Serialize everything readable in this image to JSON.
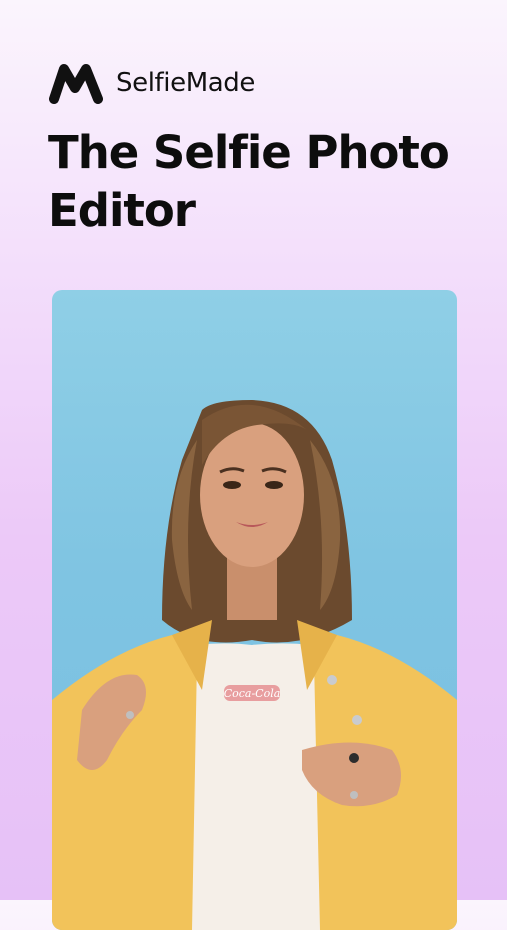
{
  "brand": {
    "name": "SelfieMade",
    "logo_icon": "selfiemade-logo-icon"
  },
  "hero": {
    "title": "The Selfie Photo Editor"
  },
  "photo": {
    "subject": "portrait-photo",
    "shirt_text": "Coca-Cola",
    "colors": {
      "background": "#7fc4e2",
      "jacket": "#f2c35a",
      "shirt": "#f5efe8",
      "hair": "#6b4a2e",
      "skin": "#d9a07e"
    }
  }
}
